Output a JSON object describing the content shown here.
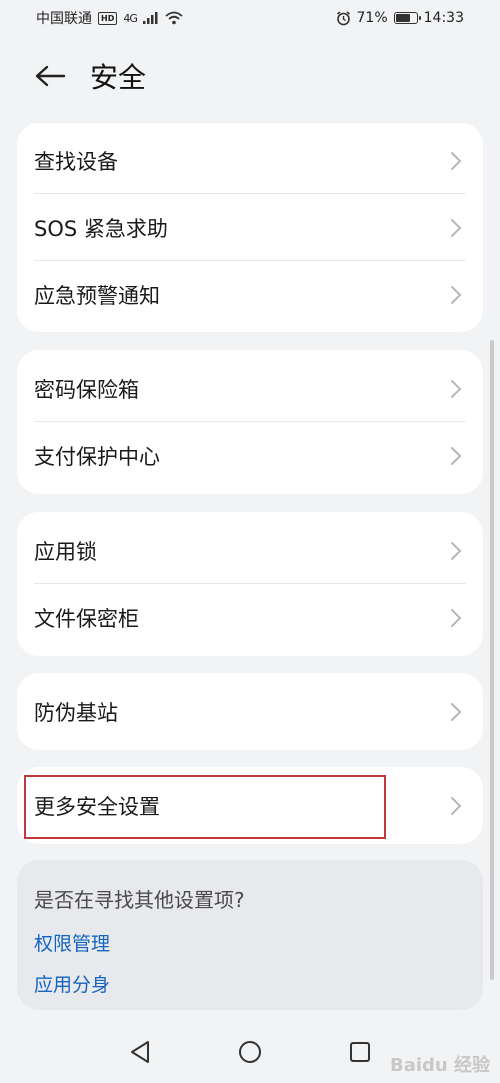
{
  "status_bar": {
    "carrier": "中国联通",
    "hd": "HD",
    "network": "4G",
    "battery_percent": "71%",
    "time": "14:33"
  },
  "header": {
    "title": "安全"
  },
  "groups": [
    {
      "items": [
        {
          "label": "查找设备"
        },
        {
          "label": "SOS 紧急求助"
        },
        {
          "label": "应急预警通知"
        }
      ]
    },
    {
      "items": [
        {
          "label": "密码保险箱"
        },
        {
          "label": "支付保护中心"
        }
      ]
    },
    {
      "items": [
        {
          "label": "应用锁"
        },
        {
          "label": "文件保密柜"
        }
      ]
    },
    {
      "items": [
        {
          "label": "防伪基站"
        }
      ]
    },
    {
      "items": [
        {
          "label": "更多安全设置"
        }
      ]
    }
  ],
  "suggestions": {
    "title": "是否在寻找其他设置项?",
    "links": [
      "权限管理",
      "应用分身"
    ]
  },
  "watermark": "Baidu 经验",
  "colors": {
    "background": "#f1f3f5",
    "card": "#ffffff",
    "link": "#1565c0",
    "highlight": "#c0393b"
  }
}
